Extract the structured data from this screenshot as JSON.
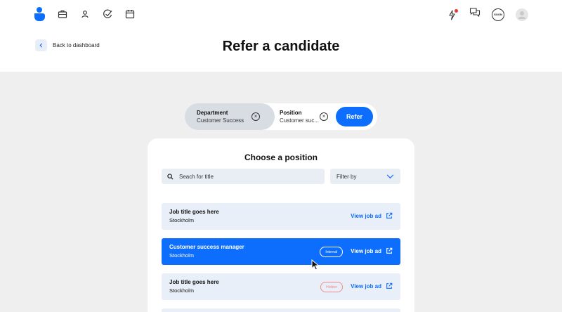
{
  "nav": {
    "icons": [
      "logo-icon",
      "briefcase-icon",
      "person-icon",
      "check-icon",
      "calendar-icon"
    ],
    "right_icons": [
      "bolt-icon",
      "chat-icon",
      "user-avatar-icon"
    ],
    "badge_text": "SOON"
  },
  "header": {
    "back_label": "Back to dashboard",
    "title": "Refer a candidate"
  },
  "selector": {
    "department_label": "Department",
    "department_value": "Customer Success",
    "position_label": "Position",
    "position_value": "Customer suc...",
    "refer_label": "Refer"
  },
  "card": {
    "title": "Choose a position",
    "search_placeholder": "Seach for title",
    "filter_label": "Filter by"
  },
  "jobs": [
    {
      "title": "Job title goes here",
      "location": "Stockholm",
      "tag": "",
      "link": "View job ad"
    },
    {
      "title": "Customer success manager",
      "location": "Stockholm",
      "tag": "Internal",
      "link": "View job ad"
    },
    {
      "title": "Job title goes here",
      "location": "Stockholm",
      "tag": "Hidden",
      "link": "View job ad"
    }
  ],
  "colors": {
    "accent": "#0d6efd",
    "background": "#efefef",
    "notification": "#e53935",
    "hidden_tag": "#f08b8b"
  }
}
